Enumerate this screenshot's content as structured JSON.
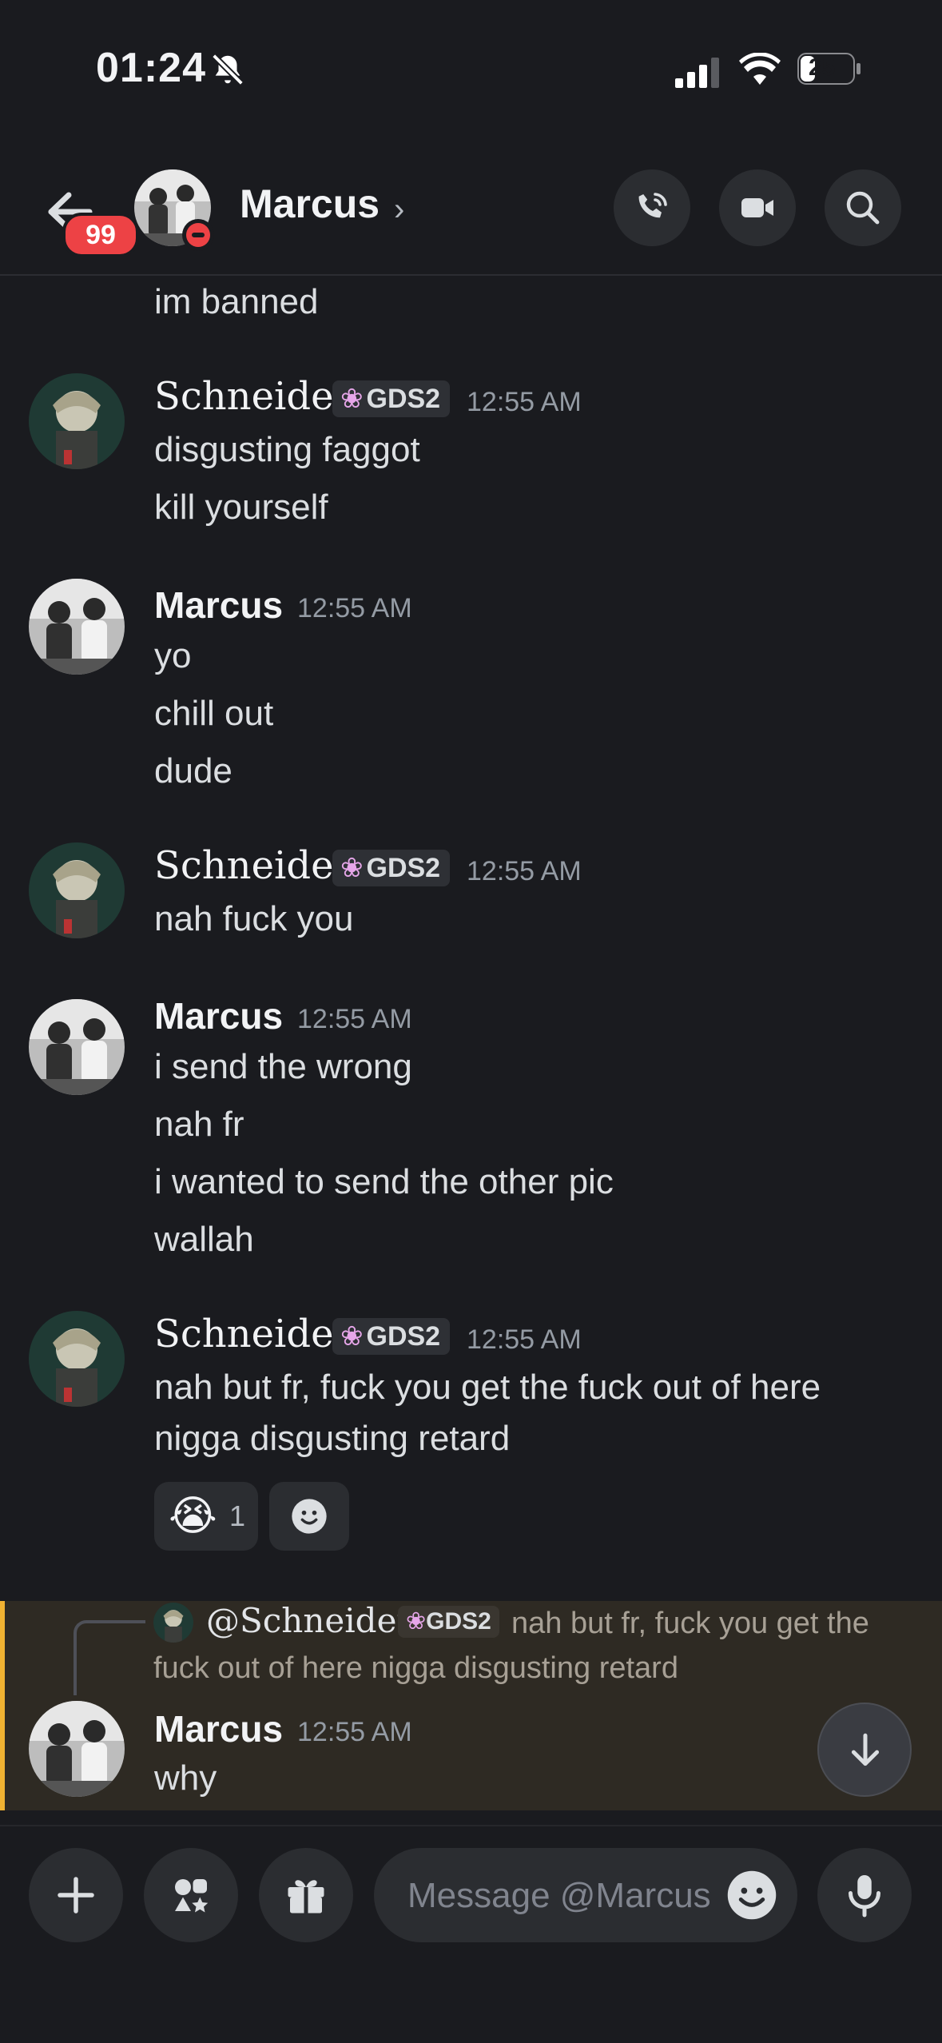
{
  "status_bar": {
    "time": "01:24",
    "battery": "25"
  },
  "header": {
    "title": "Marcus",
    "unread_badge": "99"
  },
  "messages": [
    {
      "id": "m0",
      "lines": [
        "im banned"
      ]
    },
    {
      "id": "m1",
      "author": "Schneider",
      "tag": "GDS2",
      "time": "12:55 AM",
      "lines": [
        "disgusting faggot",
        "kill yourself"
      ]
    },
    {
      "id": "m2",
      "author": "Marcus",
      "time": "12:55 AM",
      "lines": [
        "yo",
        "chill out",
        "dude"
      ]
    },
    {
      "id": "m3",
      "author": "Schneider",
      "tag": "GDS2",
      "time": "12:55 AM",
      "lines": [
        "nah fuck you"
      ]
    },
    {
      "id": "m4",
      "author": "Marcus",
      "time": "12:55 AM",
      "lines": [
        "i send the wrong",
        "nah fr",
        "i wanted to send the other pic",
        "wallah"
      ]
    },
    {
      "id": "m5",
      "author": "Schneider",
      "tag": "GDS2",
      "time": "12:55 AM",
      "lines": [
        "nah but fr, fuck you get the fuck out of here",
        "nigga disgusting retard"
      ],
      "reactions": [
        {
          "emoji": "😭",
          "count": "1"
        }
      ]
    },
    {
      "id": "m6",
      "author": "Marcus",
      "time": "12:55 AM",
      "lines": [
        "why"
      ],
      "reply": {
        "user": "@Schneider",
        "tag": "GDS2",
        "text_line1": "nah but fr, fuck you get the",
        "text_line2": "fuck out of here nigga disgusting retard"
      }
    }
  ],
  "composer": {
    "placeholder": "Message @Marcus"
  },
  "colors": {
    "background": "#1a1b1f",
    "badge": "#ed4245",
    "highlight": "#2e2a23",
    "highlight_bar": "#f0b232",
    "tag_icon": "#e6a6e9"
  }
}
